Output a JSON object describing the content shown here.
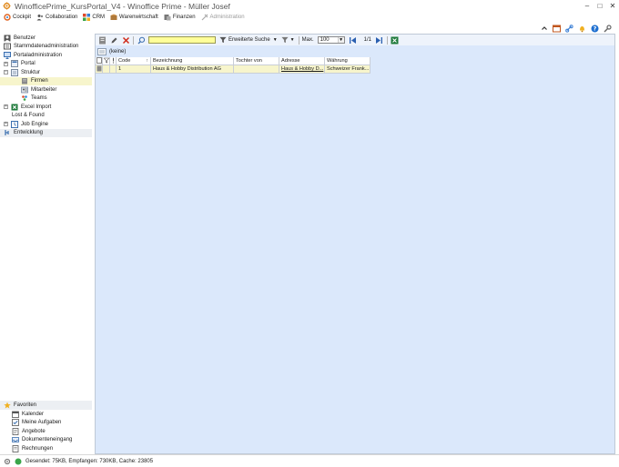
{
  "window": {
    "title": "WinofficePrime_KursPortal_V4 - Winoffice Prime - Müller Josef",
    "controls": [
      "–",
      "□",
      "✕"
    ]
  },
  "menu": [
    {
      "label": "Cockpit",
      "icon": "cockpit-icon",
      "disabled": false
    },
    {
      "label": "Collaboration",
      "icon": "collaboration-icon",
      "disabled": false
    },
    {
      "label": "CRM",
      "icon": "crm-icon",
      "disabled": false
    },
    {
      "label": "Warenwirtschaft",
      "icon": "warehouse-icon",
      "disabled": false
    },
    {
      "label": "Finanzen",
      "icon": "finance-icon",
      "disabled": false
    },
    {
      "label": "Administration",
      "icon": "administration-icon",
      "disabled": true
    }
  ],
  "nav": {
    "items": [
      {
        "label": "Benutzer"
      },
      {
        "label": "Stammdatenadministration"
      },
      {
        "label": "Portaladministration"
      },
      {
        "label": "Portal",
        "expander": "+"
      },
      {
        "label": "Struktur",
        "expander": "−"
      },
      {
        "label": "Firmen"
      },
      {
        "label": "Mitarbeiter"
      },
      {
        "label": "Teams"
      },
      {
        "label": "Excel Import",
        "expander": "+"
      },
      {
        "label": "Lost & Found"
      },
      {
        "label": "Job Engine",
        "expander": "+"
      },
      {
        "label": "Entwicklung"
      }
    ]
  },
  "favorites": {
    "title": "Favoriten",
    "items": [
      {
        "label": "Kalender"
      },
      {
        "label": "Meine Aufgaben"
      },
      {
        "label": "Angebote"
      },
      {
        "label": "Dokumenteneingang"
      },
      {
        "label": "Rechnungen"
      }
    ]
  },
  "toolbar": {
    "search_value": "",
    "advanced_search": "Erweiterte Suche",
    "max_label": "Max.",
    "max_value": "100",
    "pager": "1/1"
  },
  "grid": {
    "group_label": "(keine)",
    "columns": [
      "Code",
      "Bezeichnung",
      "Tochter von",
      "Adresse",
      "Währung"
    ],
    "rows": [
      {
        "code": "1",
        "bezeichnung": "Haus & Hobby Distribution AG",
        "tochter_von": "",
        "adresse": "Haus & Hobby D...",
        "waehrung": "Schweizer Frank..."
      }
    ]
  },
  "status": {
    "text": "Gesendet: 75KB, Empfangen: 730KB, Cache: 23805"
  },
  "colors": {
    "selection": "#f7f5cc",
    "content_bg": "#dbe8fb",
    "search_bg": "#ffff99"
  }
}
